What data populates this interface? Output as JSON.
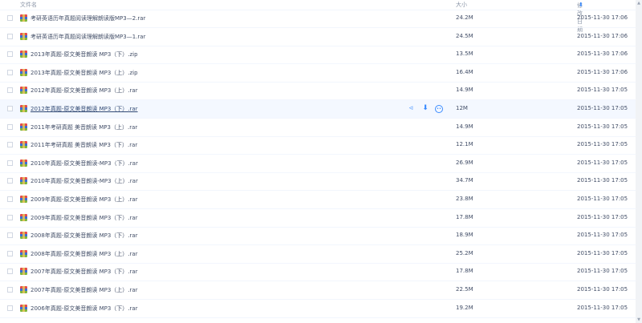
{
  "header": {
    "name": "文件名",
    "size": "大小",
    "date": "修改日期",
    "sort_icon": "sort-down-icon"
  },
  "hover_actions": {
    "share_icon": "share-icon",
    "download_icon": "download-icon",
    "more_icon": "more-icon"
  },
  "files": [
    {
      "name": "考研英语历年真题阅读理解朗读版MP3—2.rar",
      "size": "24.2M",
      "date": "2015-11-30 17:06"
    },
    {
      "name": "考研英语历年真题阅读理解朗读版MP3—1.rar",
      "size": "24.5M",
      "date": "2015-11-30 17:06"
    },
    {
      "name": "2013年真题-原文美音朗读 MP3（下）.zip",
      "size": "13.5M",
      "date": "2015-11-30 17:06"
    },
    {
      "name": "2013年真题-原文美音朗读 MP3（上）.zip",
      "size": "16.4M",
      "date": "2015-11-30 17:06"
    },
    {
      "name": "2012年真题-原文美音朗读 MP3（上）.rar",
      "size": "14.9M",
      "date": "2015-11-30 17:05"
    },
    {
      "name": "2012年真题-原文美音朗读 MP3（下）.rar",
      "size": "12M",
      "date": "2015-11-30 17:05"
    },
    {
      "name": "2011年考研真题 美音朗读 MP3（上）.rar",
      "size": "14.9M",
      "date": "2015-11-30 17:05"
    },
    {
      "name": "2011年考研真题 美音朗读 MP3（下）.rar",
      "size": "12.1M",
      "date": "2015-11-30 17:05"
    },
    {
      "name": "2010年真题-原文美音朗读-MP3（下）.rar",
      "size": "26.9M",
      "date": "2015-11-30 17:05"
    },
    {
      "name": "2010年真题-原文美音朗读-MP3（上）.rar",
      "size": "34.7M",
      "date": "2015-11-30 17:05"
    },
    {
      "name": "2009年真题-原文美音朗读 MP3（上）.rar",
      "size": "23.8M",
      "date": "2015-11-30 17:05"
    },
    {
      "name": "2009年真题-原文美音朗读 MP3（下）.rar",
      "size": "17.8M",
      "date": "2015-11-30 17:05"
    },
    {
      "name": "2008年真题-原文美音朗读 MP3（下）.rar",
      "size": "18.9M",
      "date": "2015-11-30 17:05"
    },
    {
      "name": "2008年真题-原文美音朗读 MP3（上）.rar",
      "size": "25.2M",
      "date": "2015-11-30 17:05"
    },
    {
      "name": "2007年真题-原文美音朗读 MP3（下）.rar",
      "size": "17.8M",
      "date": "2015-11-30 17:05"
    },
    {
      "name": "2007年真题-原文美音朗读 MP3（上）.rar",
      "size": "22.5M",
      "date": "2015-11-30 17:05"
    },
    {
      "name": "2006年真题-原文美音朗读 MP3（下）.rar",
      "size": "19.2M",
      "date": "2015-11-30 17:05"
    }
  ]
}
